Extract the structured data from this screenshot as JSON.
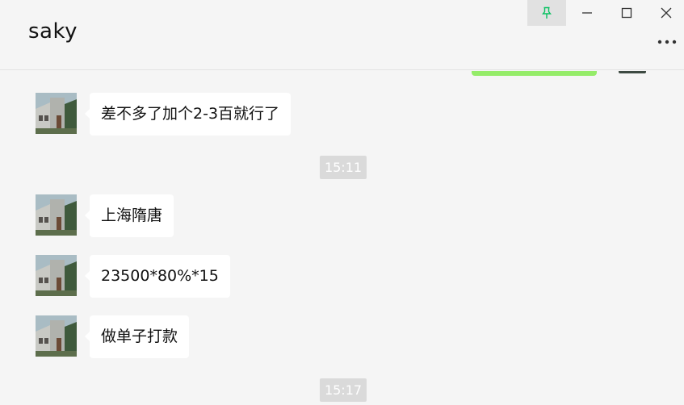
{
  "window": {
    "title": "saky",
    "controls": {
      "pin": "pin-icon",
      "minimize": "minimize-icon",
      "maximize": "maximize-icon",
      "close": "close-icon",
      "more": "more-icon"
    },
    "accent_color": "#07c160"
  },
  "chat": {
    "messages": [
      {
        "type": "received",
        "text": "差不多了加个2-3百就行了"
      },
      {
        "type": "time",
        "text": "15:11"
      },
      {
        "type": "received",
        "text": "上海隋唐"
      },
      {
        "type": "received",
        "text": "23500*80%*15"
      },
      {
        "type": "received",
        "text": "做单子打款"
      },
      {
        "type": "time",
        "text": "15:17"
      }
    ],
    "sent_bubble_color": "#95ec69",
    "received_bubble_color": "#ffffff"
  }
}
